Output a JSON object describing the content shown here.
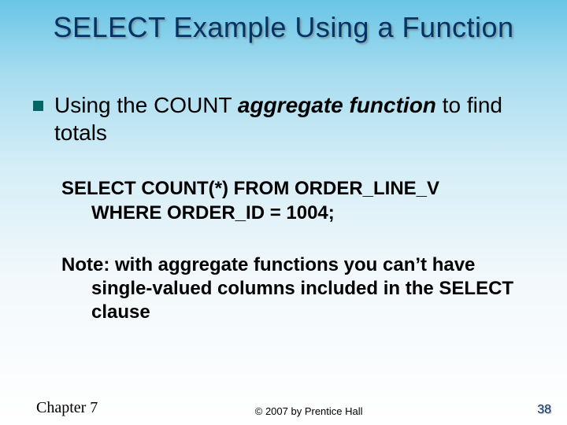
{
  "title": "SELECT Example Using a Function",
  "bullet": {
    "pre": "Using the COUNT ",
    "emph": "aggregate function",
    "post": " to find totals"
  },
  "code": {
    "line1": "SELECT COUNT(*) FROM ORDER_LINE_V",
    "line2": "WHERE ORDER_ID = 1004;"
  },
  "note": {
    "lead": "Note: with aggregate functions you can’t have",
    "cont": "single-valued columns included in the SELECT clause"
  },
  "footer": {
    "chapter": "Chapter 7",
    "copyright": "© 2007 by Prentice Hall",
    "page": "38"
  }
}
